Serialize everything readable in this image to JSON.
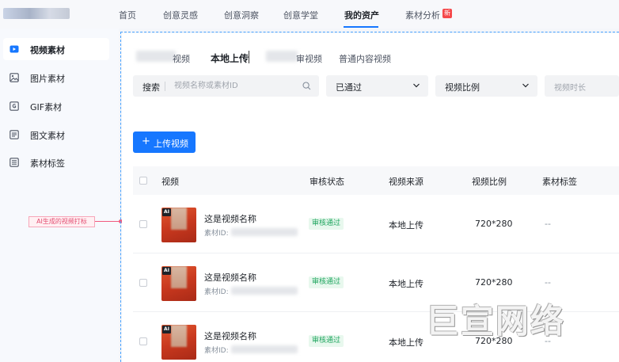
{
  "nav": {
    "items": [
      {
        "label": "首页",
        "active": false
      },
      {
        "label": "创意灵感",
        "active": false
      },
      {
        "label": "创意洞察",
        "active": false
      },
      {
        "label": "创意学堂",
        "active": false
      },
      {
        "label": "我的资产",
        "active": true
      },
      {
        "label": "素材分析",
        "active": false
      }
    ],
    "new_badge": "新"
  },
  "sidebar": {
    "items": [
      {
        "label": "视频素材",
        "icon": "video-icon",
        "active": true
      },
      {
        "label": "图片素材",
        "icon": "image-icon",
        "active": false
      },
      {
        "label": "GIF素材",
        "icon": "gif-icon",
        "active": false
      },
      {
        "label": "图文素材",
        "icon": "article-icon",
        "active": false
      },
      {
        "label": "素材标签",
        "icon": "tag-icon",
        "active": false
      }
    ]
  },
  "annotation": {
    "label": "AI生成的视频打标"
  },
  "tabs": [
    {
      "label": "视频",
      "active": false
    },
    {
      "label": "本地上传",
      "active": true
    },
    {
      "label": "审视频",
      "active": false
    },
    {
      "label": "普通内容视频",
      "active": false
    }
  ],
  "filters": {
    "search_label": "搜索",
    "search_placeholder": "视频名称或素材ID",
    "status_value": "已通过",
    "ratio_value": "视频比例",
    "duration_placeholder": "视频时长"
  },
  "upload": {
    "plus": "+",
    "label": "上传视频"
  },
  "table": {
    "headers": [
      "视频",
      "审核状态",
      "视频来源",
      "视频比例",
      "素材标签"
    ],
    "rows": [
      {
        "name": "这是视频名称",
        "id_label": "素材ID:",
        "status": "审核通过",
        "source": "本地上传",
        "ratio": "720*280",
        "tag": "--",
        "ai": "AI"
      },
      {
        "name": "这是视频名称",
        "id_label": "素材ID:",
        "status": "审核通过",
        "source": "本地上传",
        "ratio": "720*280",
        "tag": "--",
        "ai": "AI"
      },
      {
        "name": "这是视频名称",
        "id_label": "素材ID:",
        "status": "审核通过",
        "source": "本地上传",
        "ratio": "720*280",
        "tag": "--",
        "ai": "AI"
      }
    ]
  },
  "watermark": "巨宣网络",
  "colors": {
    "primary": "#1677ff",
    "success": "#1ea55e",
    "annotation": "#f05a7e",
    "badge": "#f5484a"
  }
}
